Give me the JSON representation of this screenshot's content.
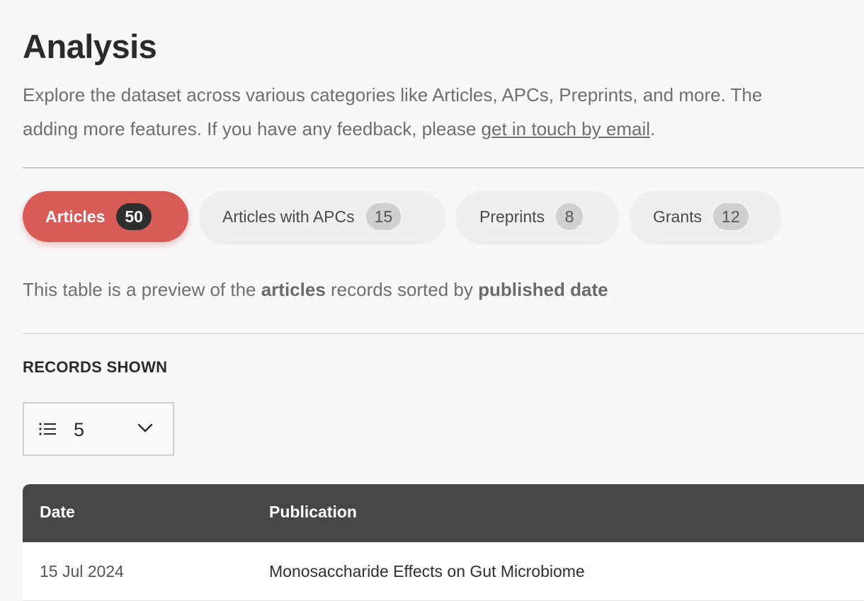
{
  "page": {
    "title": "Analysis",
    "intro_line1": "Explore the dataset across various categories like Articles, APCs, Preprints, and more. The",
    "intro_line2_prefix": "adding more features. If you have any feedback, please ",
    "intro_link": "get in touch by email",
    "intro_line2_suffix": "."
  },
  "tabs": [
    {
      "label": "Articles",
      "count": "50",
      "active": true
    },
    {
      "label": "Articles with APCs",
      "count": "15",
      "active": false
    },
    {
      "label": "Preprints",
      "count": "8",
      "active": false
    },
    {
      "label": "Grants",
      "count": "12",
      "active": false
    }
  ],
  "preview": {
    "prefix": "This table is a preview of the ",
    "entity": "articles",
    "middle": " records sorted by ",
    "sort": "published date"
  },
  "records": {
    "label": "RECORDS SHOWN",
    "selected": "5",
    "icon": "list-icon"
  },
  "table": {
    "headers": [
      "Date",
      "Publication"
    ],
    "rows": [
      [
        "15 Jul 2024",
        "Monosaccharide Effects on Gut Microbiome"
      ]
    ]
  },
  "colors": {
    "accent": "#d75c58",
    "header_bg": "#474748",
    "page_bg": "#f8f8f8"
  }
}
